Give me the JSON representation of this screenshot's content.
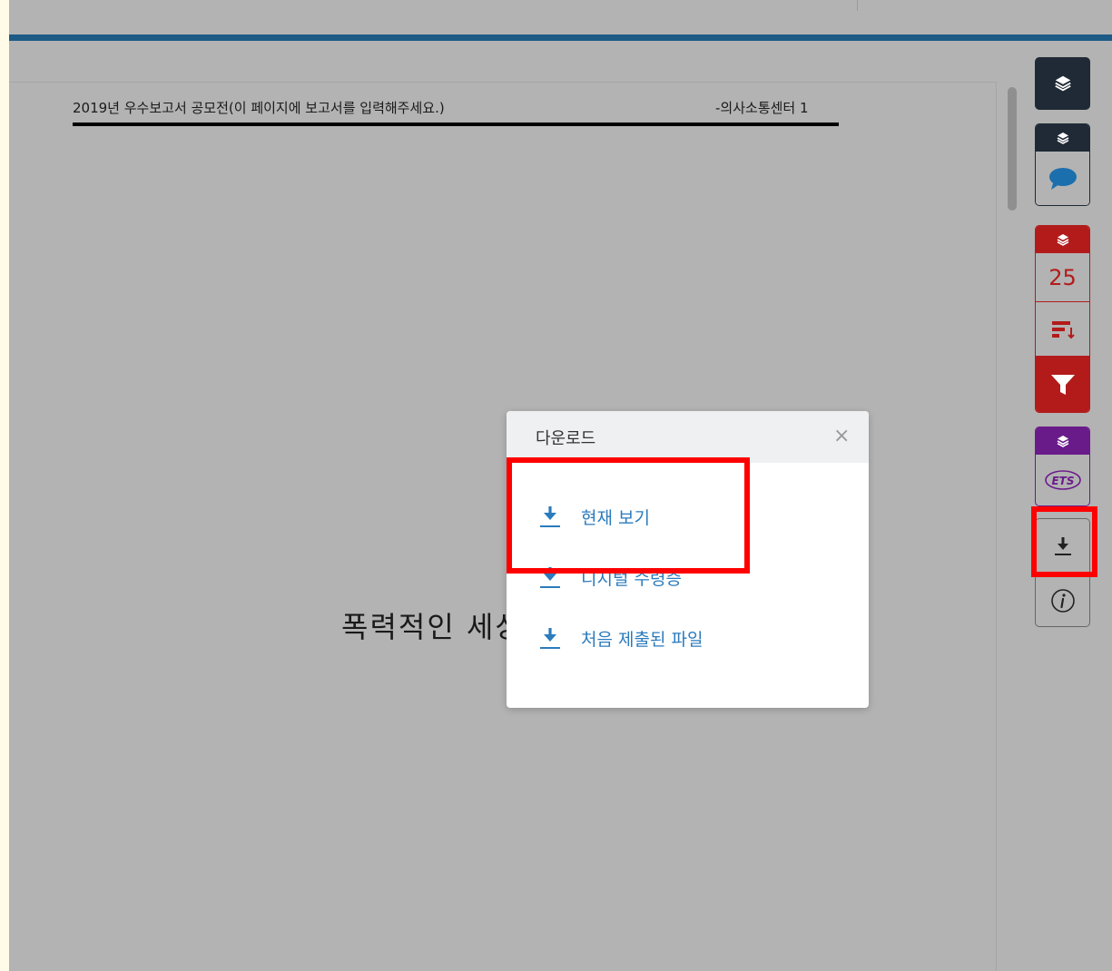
{
  "document": {
    "header_left": "2019년 우수보고서 공모전(이 페이지에 보고서를 입력해주세요.)",
    "header_right": "-의사소통센터  1",
    "title": "폭력적인 세상"
  },
  "sidebar": {
    "layers_icon": "layers-icon",
    "comment_icon": "comment-icon",
    "count": "25",
    "sort_icon": "sort-icon",
    "filter_icon": "filter-icon",
    "ets_label": "ETS",
    "download_icon": "download-icon",
    "info_icon": "info-icon"
  },
  "download_modal": {
    "title": "다운로드",
    "close": "×",
    "options": [
      {
        "label": "현재 보기",
        "icon": "download-icon"
      },
      {
        "label": "디지털 수령증",
        "icon": "download-icon"
      },
      {
        "label": "처음 제출된 파일",
        "icon": "download-icon"
      }
    ]
  },
  "colors": {
    "top_bar": "#1d5a86",
    "dark": "#1f2a36",
    "red": "#b31b1b",
    "purple": "#6a1b8a",
    "link": "#2b7bbd",
    "highlight": "#ff0000"
  }
}
